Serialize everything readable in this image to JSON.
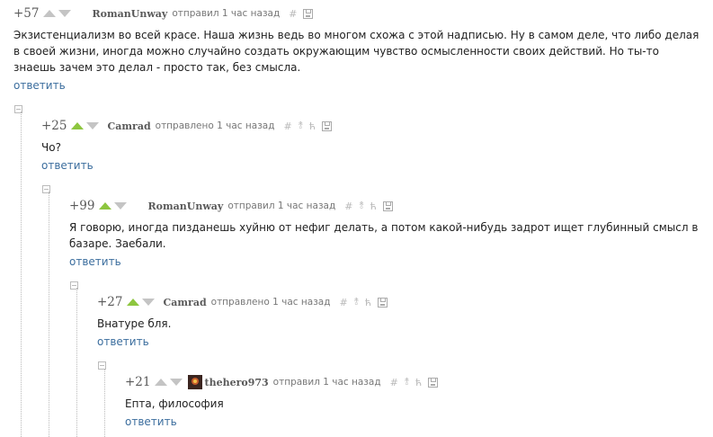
{
  "comments": [
    {
      "rating": "+57",
      "author": "RomanUnway",
      "meta": "отправил 1 час назад",
      "voted": false,
      "text": "Экзистенциализм во всей красе. Наша жизнь ведь во многом схожа с этой надписью. Ну в самом деле, что либо делая в своей жизни, иногда можно случайно создать окружающим чувство осмысленности своих действий. Но ты-то знаешь зачем это делал - просто так, без смысла.",
      "reply": "ответить"
    },
    {
      "rating": "+25",
      "author": "Camrad",
      "meta": "отправлено 1 час назад",
      "voted": true,
      "text": "Чо?",
      "reply": "ответить"
    },
    {
      "rating": "+99",
      "author": "RomanUnway",
      "meta": "отправил 1 час назад",
      "voted": true,
      "text": "Я говорю, иногда пизданешь хуйню от нефиг делать, а потом какой-нибудь задрот ищет глубинный смысл в базаре. Заебали.",
      "reply": "ответить"
    },
    {
      "rating": "+27",
      "author": "Camrad",
      "meta": "отправлено 1 час назад",
      "voted": true,
      "text": "Внатуре бля.",
      "reply": "ответить"
    },
    {
      "rating": "+21",
      "author": "thehero973",
      "meta": "отправил 1 час назад",
      "voted": false,
      "text": "Епта, философия",
      "reply": "ответить"
    }
  ],
  "toolbar": {
    "hash": "#",
    "pin": "⥉",
    "parent": "ћ"
  }
}
